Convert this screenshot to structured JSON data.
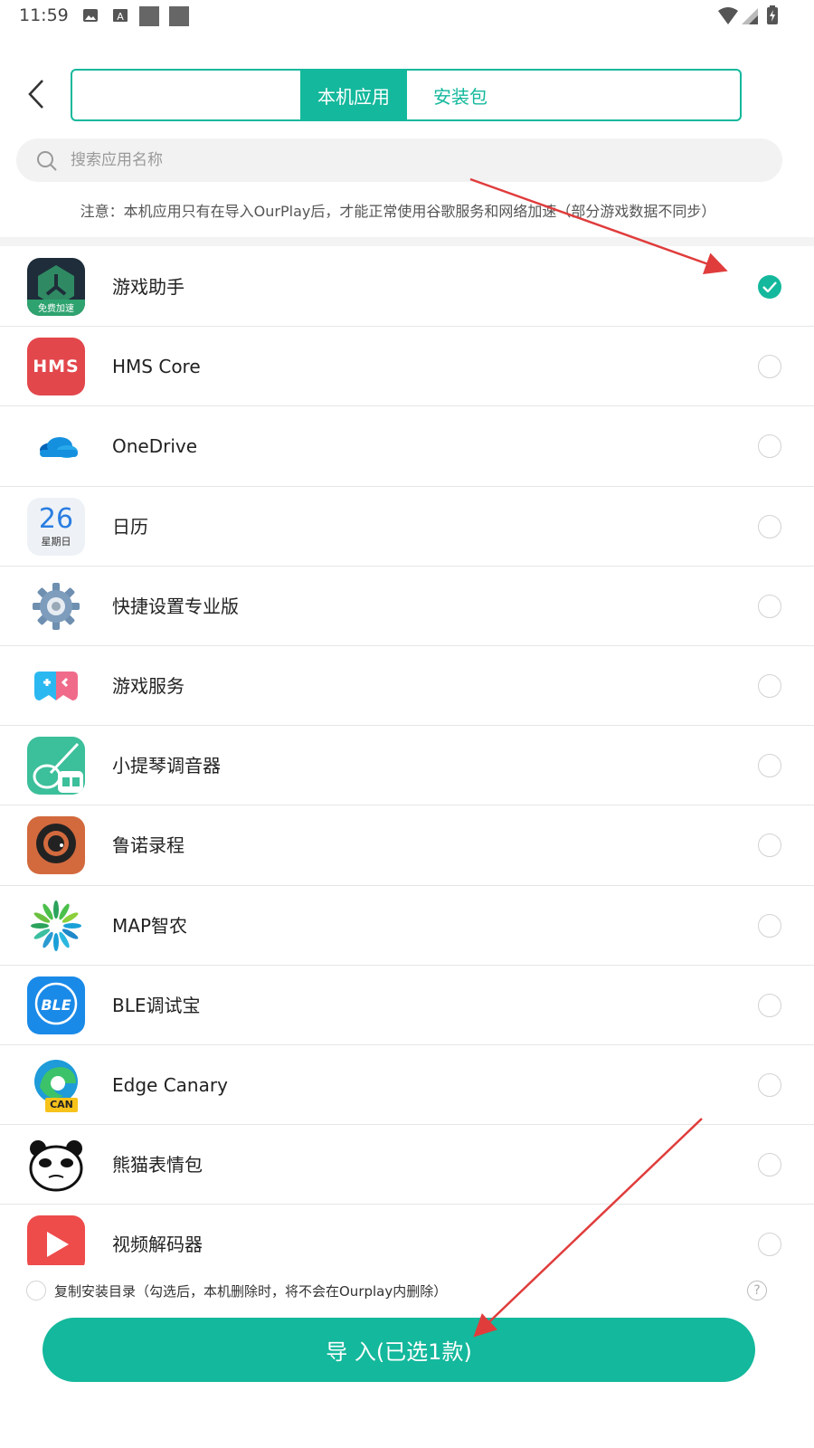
{
  "status_bar": {
    "time": "11:59",
    "icons": [
      "image-icon",
      "font-a-icon",
      "square-icon",
      "square-icon",
      "wifi-icon",
      "signal-icon",
      "battery-icon"
    ]
  },
  "header": {
    "back_icon": "chevron-left-icon",
    "tabs": [
      {
        "label": "本机应用",
        "active": true
      },
      {
        "label": "安装包",
        "active": false
      }
    ]
  },
  "search": {
    "placeholder": "搜索应用名称",
    "value": ""
  },
  "notice": "注意：本机应用只有在导入OurPlay后，才能正常使用谷歌服务和网络加速（部分游戏数据不同步）",
  "apps": [
    {
      "name": "游戏助手",
      "selected": true,
      "icon": "game-assistant-icon",
      "badge": "免费加速"
    },
    {
      "name": "HMS Core",
      "selected": false,
      "icon": "hms-core-icon",
      "badge": "HMS"
    },
    {
      "name": "OneDrive",
      "selected": false,
      "icon": "onedrive-icon"
    },
    {
      "name": "日历",
      "selected": false,
      "icon": "calendar-icon",
      "day": "26",
      "weekday": "星期日"
    },
    {
      "name": "快捷设置专业版",
      "selected": false,
      "icon": "gear-icon"
    },
    {
      "name": "游戏服务",
      "selected": false,
      "icon": "gamepad-icon"
    },
    {
      "name": "小提琴调音器",
      "selected": false,
      "icon": "violin-icon"
    },
    {
      "name": "鲁诺录程",
      "selected": false,
      "icon": "recorder-icon"
    },
    {
      "name": "MAP智农",
      "selected": false,
      "icon": "flower-icon"
    },
    {
      "name": "BLE调试宝",
      "selected": false,
      "icon": "ble-icon",
      "badge": "BLE"
    },
    {
      "name": "Edge Canary",
      "selected": false,
      "icon": "edge-canary-icon",
      "badge": "CAN"
    },
    {
      "name": "熊猫表情包",
      "selected": false,
      "icon": "panda-icon"
    },
    {
      "name": "视频解码器",
      "selected": false,
      "icon": "play-icon"
    }
  ],
  "footer": {
    "copy_label": "复制安装目录（勾选后，本机删除时，将不会在Ourplay内删除）",
    "copy_checked": false,
    "help_icon": "question-icon",
    "help_glyph": "?",
    "import_label": "导 入(已选1款)"
  },
  "colors": {
    "accent": "#14b89c",
    "annotation_arrow": "#e03c3c"
  }
}
